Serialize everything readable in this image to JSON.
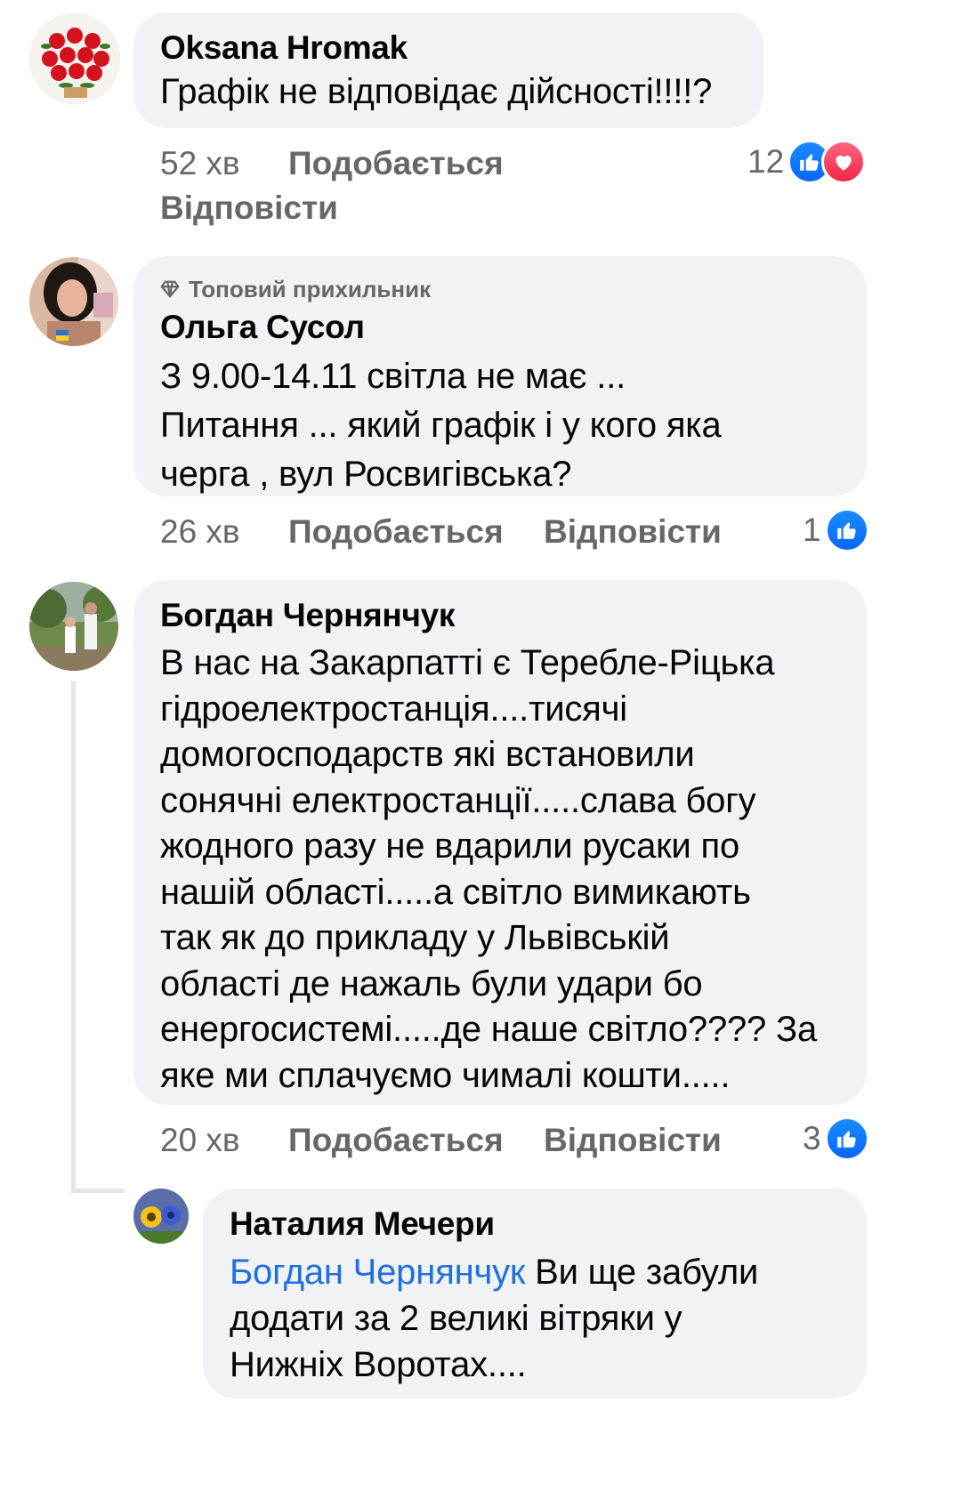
{
  "comments": [
    {
      "author": "Oksana Hromak",
      "lines": [
        "Графік не відповідає дійсності!!!!?"
      ],
      "time": "52 хв",
      "like_label": "Подобається",
      "reply_label": "Відповісти",
      "reaction_count": "12",
      "reactions": [
        "like-icon",
        "love-icon"
      ]
    },
    {
      "badge": "Топовий прихильник",
      "author": "Ольга Сусол",
      "lines": [
        "З 9.00-14.11 світла не має ...",
        "Питання ... який графік і у кого яка",
        "черга , вул Росвигівська?"
      ],
      "time": "26 хв",
      "like_label": "Подобається",
      "reply_label": "Відповісти",
      "reaction_count": "1",
      "reactions": [
        "like-icon"
      ]
    },
    {
      "author": "Богдан Чернянчук",
      "lines": [
        "В нас на Закарпатті є Теребле-Ріцька",
        "гідроелектростанція....тисячі",
        "домогосподарств які встановили",
        "сонячні електростанції.....слава богу",
        "жодного разу не вдарили русаки по",
        "нашій області.....а світло вимикають",
        "так як до прикладу у Львівській",
        "області де нажаль були удари бо",
        "енергосистемі.....де наше світло???? За",
        "яке ми сплачуємо чималі кошти....."
      ],
      "time": "20 хв",
      "like_label": "Подобається",
      "reply_label": "Відповісти",
      "reaction_count": "3",
      "reactions": [
        "like-icon"
      ]
    },
    {
      "author": "Наталия Мечери",
      "mention": "Богдан Чернянчук",
      "first_line_rest": " Ви ще забули",
      "lines": [
        "додати за 2 великі вітряки у",
        "Нижніх Воротах...."
      ]
    }
  ],
  "colors": {
    "bubble": "#f0f2f5",
    "meta_text": "#65676b",
    "mention": "#216fdb",
    "like": "#0866ff",
    "love": "#f0284a"
  }
}
